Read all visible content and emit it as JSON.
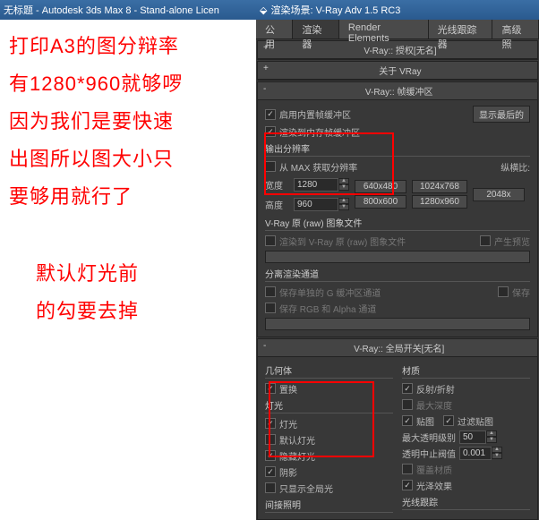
{
  "left_title": "无标题 - Autodesk 3ds Max 8 - Stand-alone Licen",
  "right_title": "渲染场景: V-Ray Adv 1.5 RC3",
  "annotations": {
    "line1": "打印A3的图分辩率",
    "line2": "有1280*960就够啰",
    "line3": "因为我们是要快速",
    "line4": "出图所以图大小只",
    "line5": "要够用就行了",
    "line6": "默认灯光前",
    "line7": "的勾要去掉"
  },
  "tabs": [
    "公用",
    "渲染器",
    "Render Elements",
    "光线跟踪器",
    "高级照"
  ],
  "rollups": {
    "auth": "V-Ray:: 授权[无名]",
    "about": "关于 VRay",
    "framebuf_title": "V-Ray:: 帧缓冲区",
    "framebuf": {
      "enable": "启用内置帧缓冲区",
      "rendermem": "渲染到内存帧缓冲区",
      "showlast": "显示最后的"
    },
    "outres_title": "输出分辨率",
    "outres": {
      "frommax": "从 MAX 获取分辨率",
      "aspect": "纵横比:",
      "width_lbl": "宽度",
      "width_val": "1280",
      "height_lbl": "高度",
      "height_val": "960",
      "presets": [
        "640x480",
        "1024x768",
        "800x600",
        "1280x960",
        "2048x"
      ]
    },
    "rawimg": {
      "title": "V-Ray 原 (raw) 图象文件",
      "render": "渲染到 V-Ray 原 (raw) 图象文件",
      "preview": "产生预览"
    },
    "split": {
      "title": "分离渲染通道",
      "savegbuf": "保存单独的 G 缓冲区通道",
      "save": "保存"
    },
    "global_title": "V-Ray:: 全局开关[无名]",
    "global": {
      "geom": "几何体",
      "displace": "置换",
      "lights_grp": "灯光",
      "lights": "灯光",
      "defaultlights": "默认灯光",
      "hiddenlights": "隐藏灯光",
      "shadows": "阴影",
      "showgi": "只显示全局光",
      "materials": "材质",
      "reflrefr": "反射/折射",
      "maxdepth": "最大深度",
      "maps": "贴图",
      "filtermaps": "过滤贴图",
      "maxtransp": "最大透明级别",
      "maxtransp_val": "50",
      "transpcut": "透明中止阀值",
      "transpcut_val": "0.001",
      "override": "覆盖材质",
      "gloss": "光泽效果",
      "indirect": "间接照明",
      "raytrace": "光线跟踪"
    }
  }
}
